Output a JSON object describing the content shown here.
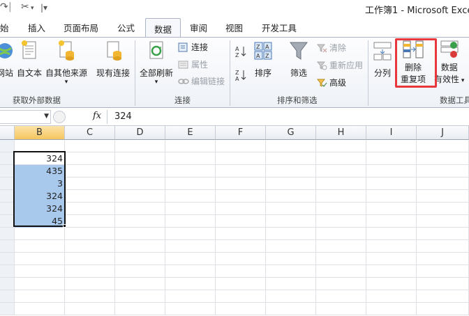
{
  "window": {
    "title": "工作簿1 - Microsoft Excel"
  },
  "quick_access": {
    "undo_icon": "undo-icon",
    "customize_icon": "customize-toolbar-icon"
  },
  "tabs": [
    {
      "label": "始"
    },
    {
      "label": "插入"
    },
    {
      "label": "页面布局"
    },
    {
      "label": "公式"
    },
    {
      "label": "数据",
      "active": true
    },
    {
      "label": "审阅"
    },
    {
      "label": "视图"
    },
    {
      "label": "开发工具"
    }
  ],
  "ribbon": {
    "get_external": {
      "group_label": "获取外部数据",
      "from_web": "网站",
      "from_text": "自文本",
      "from_other": "自其他来源",
      "existing": "现有连接"
    },
    "connections": {
      "group_label": "连接",
      "refresh_all": "全部刷新",
      "connections": "连接",
      "properties": "属性",
      "edit_links": "编辑链接"
    },
    "sort_filter": {
      "group_label": "排序和筛选",
      "sort": "排序",
      "filter": "筛选",
      "clear": "清除",
      "reapply": "重新应用",
      "advanced": "高级"
    },
    "data_tools": {
      "group_label": "数据工具",
      "text_to_columns": "分列",
      "remove_dup_line1": "删除",
      "remove_dup_line2": "重复项",
      "validation_line1": "数据",
      "validation_line2": "有效性"
    }
  },
  "formula_bar": {
    "fx": "fx",
    "value": "324"
  },
  "columns": [
    "B",
    "C",
    "D",
    "E",
    "F",
    "G",
    "H",
    "I",
    "J"
  ],
  "cells": [
    "324",
    "435",
    "3",
    "324",
    "324",
    "45"
  ],
  "colors": {
    "highlight": "#e8383d",
    "selection_fill": "#a8c8ec",
    "active_column": "#f6c65f"
  }
}
